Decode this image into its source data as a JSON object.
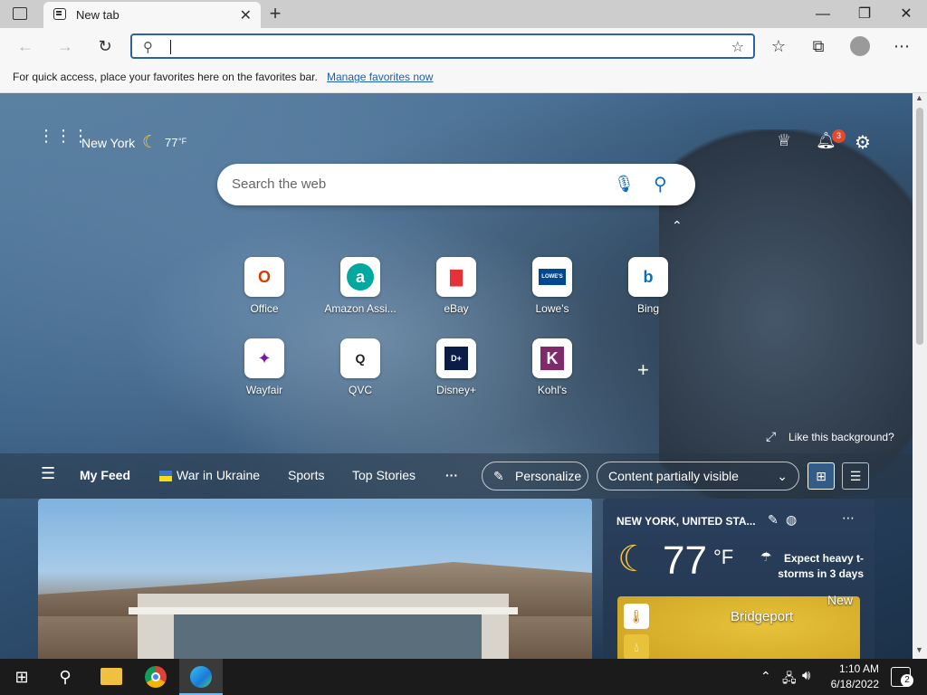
{
  "browser": {
    "tab_title": "New tab",
    "new_tab_plus": "+",
    "favorites_message": "For quick access, place your favorites here on the favorites bar.",
    "manage_favorites_link": "Manage favorites now"
  },
  "header": {
    "location": "New York",
    "temperature": "77",
    "temp_unit": "°F",
    "notification_count": "3"
  },
  "search": {
    "placeholder": "Search the web"
  },
  "quick_links": [
    {
      "label": "Office",
      "color": "#d83b01",
      "glyph": "O"
    },
    {
      "label": "Amazon Assi...",
      "color": "#00a8a0",
      "glyph": "a"
    },
    {
      "label": "eBay",
      "color": "#e53238",
      "glyph": "▇"
    },
    {
      "label": "Lowe's",
      "color": "#004990",
      "glyph": "LOWE'S"
    },
    {
      "label": "Bing",
      "color": "#0f6cbd",
      "glyph": "b"
    },
    {
      "label": "Wayfair",
      "color": "#7b189f",
      "glyph": "✦"
    },
    {
      "label": "QVC",
      "color": "#222222",
      "glyph": "Q"
    },
    {
      "label": "Disney+",
      "color": "#0b1c48",
      "glyph": "D+"
    },
    {
      "label": "Kohl's",
      "color": "#7e2a6b",
      "glyph": "K"
    }
  ],
  "background": {
    "like_text": "Like this background?"
  },
  "feed": {
    "items": [
      "My Feed",
      "War in Ukraine",
      "Sports",
      "Top Stories"
    ],
    "more": "···",
    "personalize": "Personalize",
    "visibility": "Content partially visible"
  },
  "weather": {
    "location": "NEW YORK, UNITED STA...",
    "temp": "77",
    "unit": "°F",
    "alert": "Expect heavy t-storms in 3 days",
    "map_city": "Bridgeport",
    "map_corner": "New"
  },
  "taskbar": {
    "time": "1:10 AM",
    "date": "6/18/2022",
    "notification_count": "2"
  }
}
